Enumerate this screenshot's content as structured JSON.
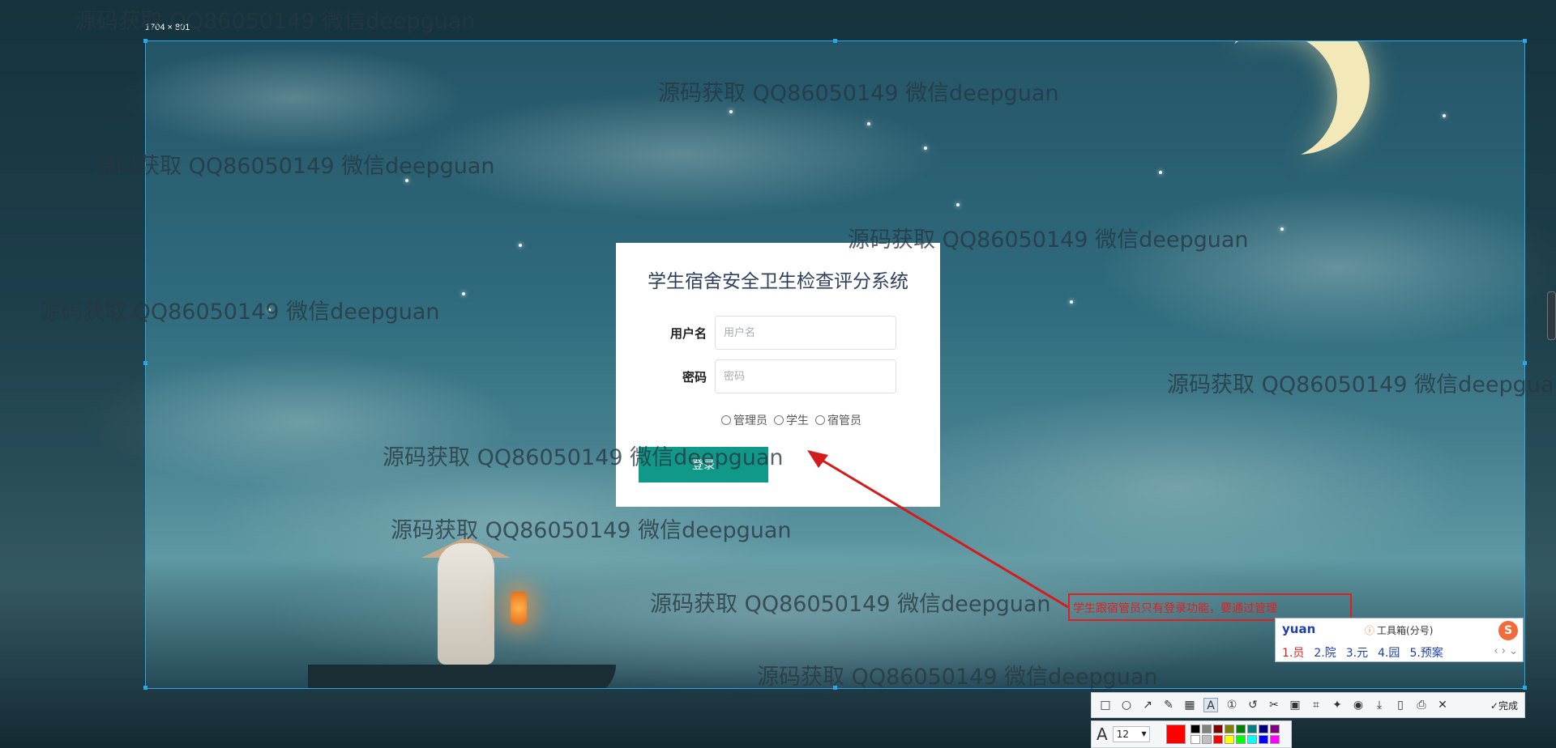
{
  "selection_size": "1704 × 801",
  "login": {
    "title": "学生宿舍安全卫生检查评分系统",
    "username_label": "用户名",
    "username_placeholder": "用户名",
    "password_label": "密码",
    "password_placeholder": "密码",
    "roles": [
      "管理员",
      "学生",
      "宿管员"
    ],
    "login_button": "登录"
  },
  "watermark_text": "源码获取 QQ86050149 微信deepguan",
  "annotation": {
    "text": "学生跟宿管员只有登录功能，要通过管理",
    "color": "#e0201e"
  },
  "ime": {
    "input": "yuan",
    "toolbox": "工具箱(分号)",
    "candidates": [
      "1.员",
      "2.院",
      "3.元",
      "4.园",
      "5.预案"
    ],
    "logo": "S"
  },
  "toolbar": {
    "icons": [
      "rectangle-icon",
      "ellipse-icon",
      "arrow-icon",
      "pencil-icon",
      "mosaic-icon",
      "text-icon",
      "number-icon",
      "undo-icon",
      "pin-icon",
      "ocr-icon",
      "capture-icon",
      "pin2-icon",
      "record-icon",
      "download-icon",
      "phone-icon",
      "save-icon",
      "close-icon"
    ],
    "done_label": "完成",
    "font_size": "12",
    "current_color": "#ff0000",
    "palette": [
      "#000000",
      "#808080",
      "#800000",
      "#808000",
      "#008000",
      "#008080",
      "#000080",
      "#800080",
      "#ffffff",
      "#c0c0c0",
      "#ff0000",
      "#ffff00",
      "#00ff00",
      "#00ffff",
      "#0000ff",
      "#ff00ff"
    ]
  },
  "colors": {
    "accent_button": "#109888",
    "selection_border": "#2aa7e8"
  }
}
